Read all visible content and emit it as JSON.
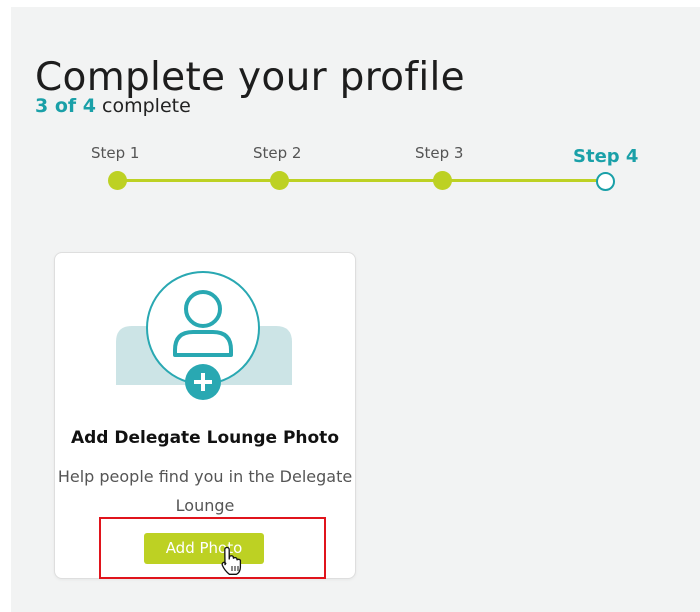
{
  "page": {
    "title": "Complete your profile",
    "progress_count": "3 of 4",
    "progress_suffix": "complete"
  },
  "stepper": {
    "steps": [
      {
        "label": "Step 1",
        "state": "done"
      },
      {
        "label": "Step 2",
        "state": "done"
      },
      {
        "label": "Step 3",
        "state": "done"
      },
      {
        "label": "Step 4",
        "state": "current"
      }
    ],
    "completed_steps": 3,
    "total_steps": 4
  },
  "card": {
    "title": "Add Delegate Lounge Photo",
    "description": "Help people find you in the Delegate Lounge",
    "button_label": "Add Photo",
    "icons": [
      "user-avatar-icon",
      "plus-icon"
    ]
  },
  "overlay": {
    "highlight": "red-outline",
    "cursor_icon": "hand-pointer-icon"
  },
  "colors": {
    "accent_teal": "#1aa0a8",
    "accent_lime": "#bdd123",
    "highlight_red": "#e0141c",
    "panel_background": "#f2f3f3"
  }
}
